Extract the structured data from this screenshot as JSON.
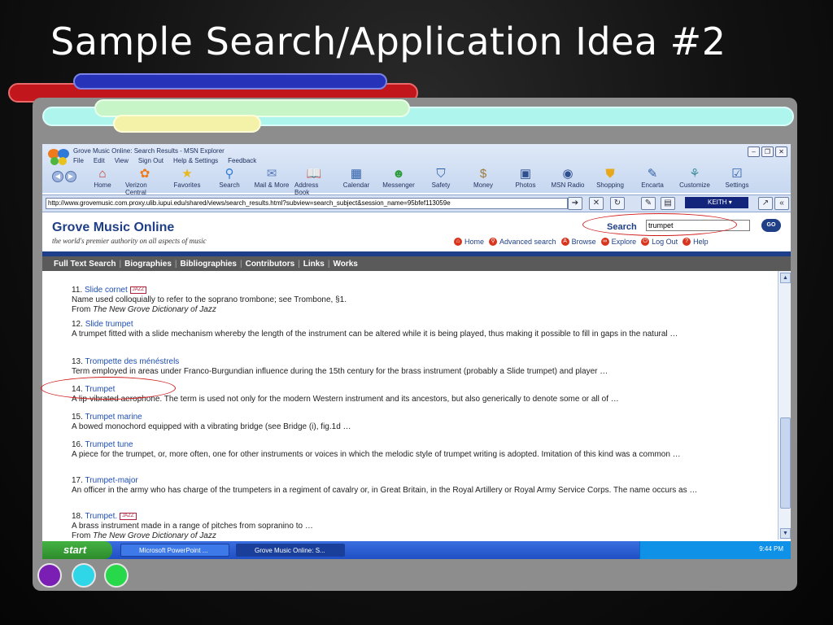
{
  "slide": {
    "title": "Sample Search/Application Idea #2"
  },
  "browser": {
    "window_title": "Grove Music Online: Search Results - MSN Explorer",
    "menu": [
      "File",
      "Edit",
      "View",
      "Sign Out",
      "Help & Settings",
      "Feedback"
    ],
    "toolbar": [
      {
        "label": "Home",
        "icon": "home-icon"
      },
      {
        "label": "Verizon Central",
        "icon": "verizon-icon"
      },
      {
        "label": "Favorites",
        "icon": "star-icon"
      },
      {
        "label": "Search",
        "icon": "search-icon"
      },
      {
        "label": "Mail & More",
        "icon": "mail-icon"
      },
      {
        "label": "Address Book",
        "icon": "address-book-icon"
      },
      {
        "label": "Calendar",
        "icon": "calendar-icon"
      },
      {
        "label": "Messenger",
        "icon": "messenger-icon"
      },
      {
        "label": "Safety",
        "icon": "shield-icon"
      },
      {
        "label": "Money",
        "icon": "money-icon"
      },
      {
        "label": "Photos",
        "icon": "camera-icon"
      },
      {
        "label": "MSN Radio",
        "icon": "radio-icon"
      },
      {
        "label": "Shopping",
        "icon": "shopping-icon"
      },
      {
        "label": "Encarta",
        "icon": "encarta-icon"
      },
      {
        "label": "Customize",
        "icon": "customize-icon"
      },
      {
        "label": "Settings",
        "icon": "settings-icon"
      }
    ],
    "address": "http://www.grovemusic.com.proxy.ulib.iupui.edu/shared/views/search_results.html?subview=search_subject&session_name=95bfef113059e",
    "user": "KEITH"
  },
  "grove": {
    "title": "Grove Music Online",
    "tagline": "the world's premier authority on all aspects of music",
    "search_label": "Search",
    "search_value": "trumpet",
    "go_label": "GO",
    "nav": [
      "Home",
      "Advanced search",
      "Browse",
      "Explore",
      "Log Out",
      "Help"
    ],
    "tabs": [
      "Full Text Search",
      "Biographies",
      "Bibliographies",
      "Contributors",
      "Links",
      "Works"
    ]
  },
  "results": [
    {
      "num": "11",
      "title": "Slide cornet",
      "jazz": true,
      "desc": "Name used colloquially to refer to the soprano trombone; see Trombone, §1.",
      "src_prefix": "From ",
      "src": "The New Grove Dictionary of Jazz"
    },
    {
      "num": "12",
      "title": "Slide trumpet",
      "jazz": false,
      "desc": "A trumpet fitted with a slide mechanism whereby the length of the instrument can be altered while it is being played, thus making it possible to fill in gaps in the natural …",
      "src_prefix": "",
      "src": ""
    },
    {
      "num": "13",
      "title": "Trompette des ménéstrels",
      "jazz": false,
      "desc": "Term employed in areas under Franco-Burgundian influence during the 15th century for the brass instrument (probably a Slide trumpet) and player …",
      "src_prefix": "",
      "src": ""
    },
    {
      "num": "14",
      "title": "Trumpet",
      "jazz": false,
      "desc": "A lip-vibrated aerophone. The term is used not only for the modern Western instrument and its ancestors, but also generically to denote some or all of …",
      "src_prefix": "",
      "src": ""
    },
    {
      "num": "15",
      "title": "Trumpet marine",
      "jazz": false,
      "desc": "A bowed monochord equipped with a vibrating bridge (see Bridge (i), fig.1d …",
      "src_prefix": "",
      "src": ""
    },
    {
      "num": "16",
      "title": "Trumpet tune",
      "jazz": false,
      "desc": "A piece for the trumpet, or, more often, one for other instruments or voices in which the melodic style of trumpet writing is adopted. Imitation of this kind was a common …",
      "src_prefix": "",
      "src": ""
    },
    {
      "num": "17",
      "title": "Trumpet-major",
      "jazz": false,
      "desc": "An officer in the army who has charge of the trumpeters in a regiment of cavalry or, in Great Britain, in the Royal Artillery or Royal Army Service Corps. The name occurs as …",
      "src_prefix": "",
      "src": ""
    },
    {
      "num": "18",
      "title": "Trumpet.",
      "jazz": true,
      "desc": "A brass instrument made in a range of pitches from sopranino to …",
      "src_prefix": "From ",
      "src": "The New Grove Dictionary of Jazz"
    }
  ],
  "jazz_badge": "JAZZ",
  "taskbar": {
    "start": "start",
    "tasks": [
      "Microsoft PowerPoint ...",
      "Grove Music Online: S..."
    ],
    "clock": "9:44 PM"
  },
  "colors": {
    "grove_blue": "#1f3f86",
    "link_blue": "#1f4fb4",
    "annotation_red": "#d01a1a",
    "circle_purple": "#7b1fb4",
    "circle_cyan": "#2fd6e8",
    "circle_green": "#27d84a"
  }
}
